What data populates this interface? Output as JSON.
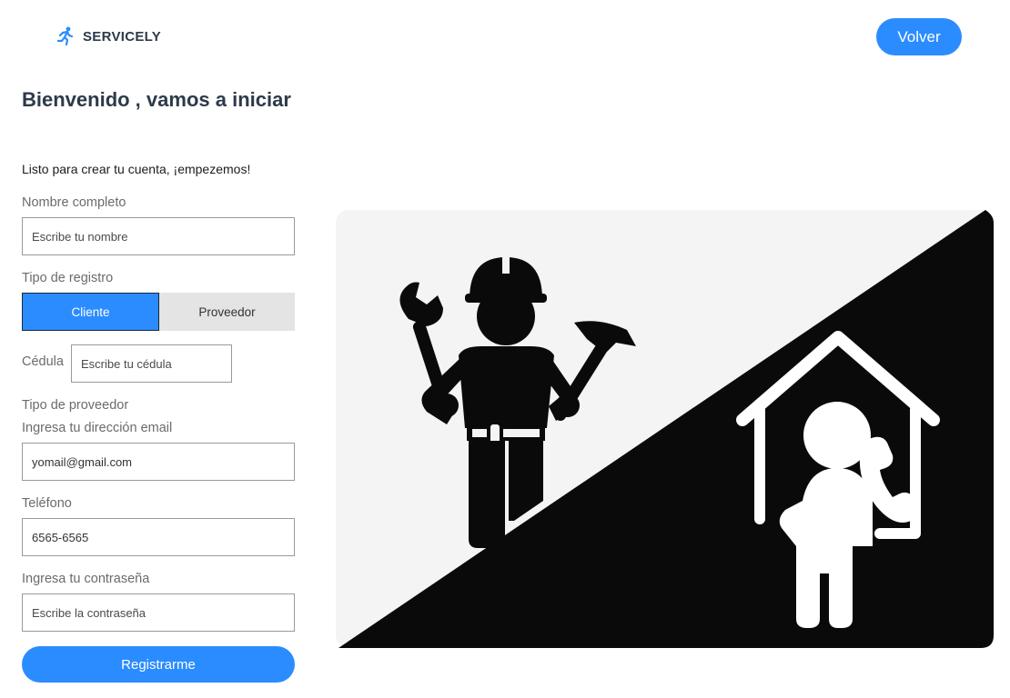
{
  "header": {
    "brand": "SERVICELY",
    "brand_icon": "running-person-icon",
    "back_label": "Volver"
  },
  "form": {
    "title": "Bienvenido , vamos a iniciar",
    "subtitle": "Listo para crear tu cuenta, ¡empezemos!",
    "name": {
      "label": "Nombre completo",
      "placeholder": "Escribe tu nombre"
    },
    "registration_type": {
      "label": "Tipo de registro",
      "options": [
        "Cliente",
        "Proveedor"
      ],
      "selected": "Cliente"
    },
    "cedula": {
      "label": "Cédula",
      "placeholder": "Escribe tu cédula"
    },
    "provider_type": {
      "label": "Tipo de proveedor"
    },
    "email": {
      "label": "Ingresa tu dirección email",
      "value": "yomail@gmail.com"
    },
    "phone": {
      "label": "Teléfono",
      "value": "6565-6565"
    },
    "password": {
      "label": "Ingresa tu contraseña",
      "placeholder": "Escribe la contraseña"
    },
    "submit_label": "Registrarme"
  },
  "colors": {
    "accent": "#2b8cff",
    "heading": "#2d3a4a",
    "illustration_dark": "#0a0a0a",
    "illustration_light": "#f4f4f4"
  }
}
